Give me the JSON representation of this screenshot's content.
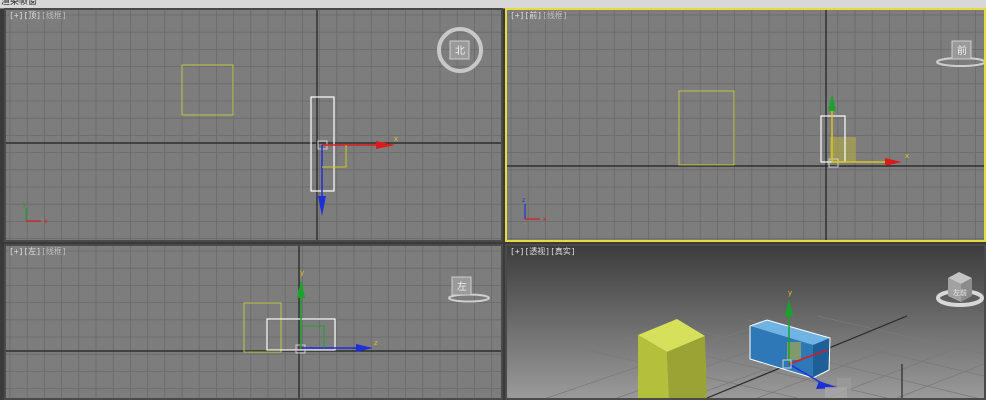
{
  "app": {
    "menu_fragment": "渲染帧窗"
  },
  "viewports": [
    {
      "id": "top",
      "bracket": "[+]",
      "view": "[顶]",
      "shading": "[线框]",
      "active": false,
      "viewcube_label": "北",
      "axis_h": "x",
      "axis_v": "y"
    },
    {
      "id": "front",
      "bracket": "[+]",
      "view": "[前]",
      "shading": "[线框]",
      "active": true,
      "viewcube_label": "前",
      "axis_h": "x",
      "axis_v": "z"
    },
    {
      "id": "left",
      "bracket": "[+]",
      "view": "[左]",
      "shading": "[线框]",
      "active": false,
      "viewcube_label": "左",
      "axis_h": "z",
      "axis_v": "y"
    },
    {
      "id": "perspective",
      "bracket": "[+]",
      "view": "[透视]",
      "shading": "[真实]",
      "active": false,
      "viewcube_label": "左前",
      "axis_v": "y"
    }
  ],
  "colors": {
    "viewport_bg": "#7d7d7d",
    "grid_line": "#6b6b6b",
    "world_axis": "#1e1e1e",
    "active_border": "#e8dc3c",
    "box_green": "#b9c64a",
    "selected_blue": "#2e78b8",
    "gizmo_x": "#d81c1c",
    "gizmo_y": "#19a32a",
    "gizmo_z": "#1f2fd8",
    "selection_white": "#ffffff"
  }
}
